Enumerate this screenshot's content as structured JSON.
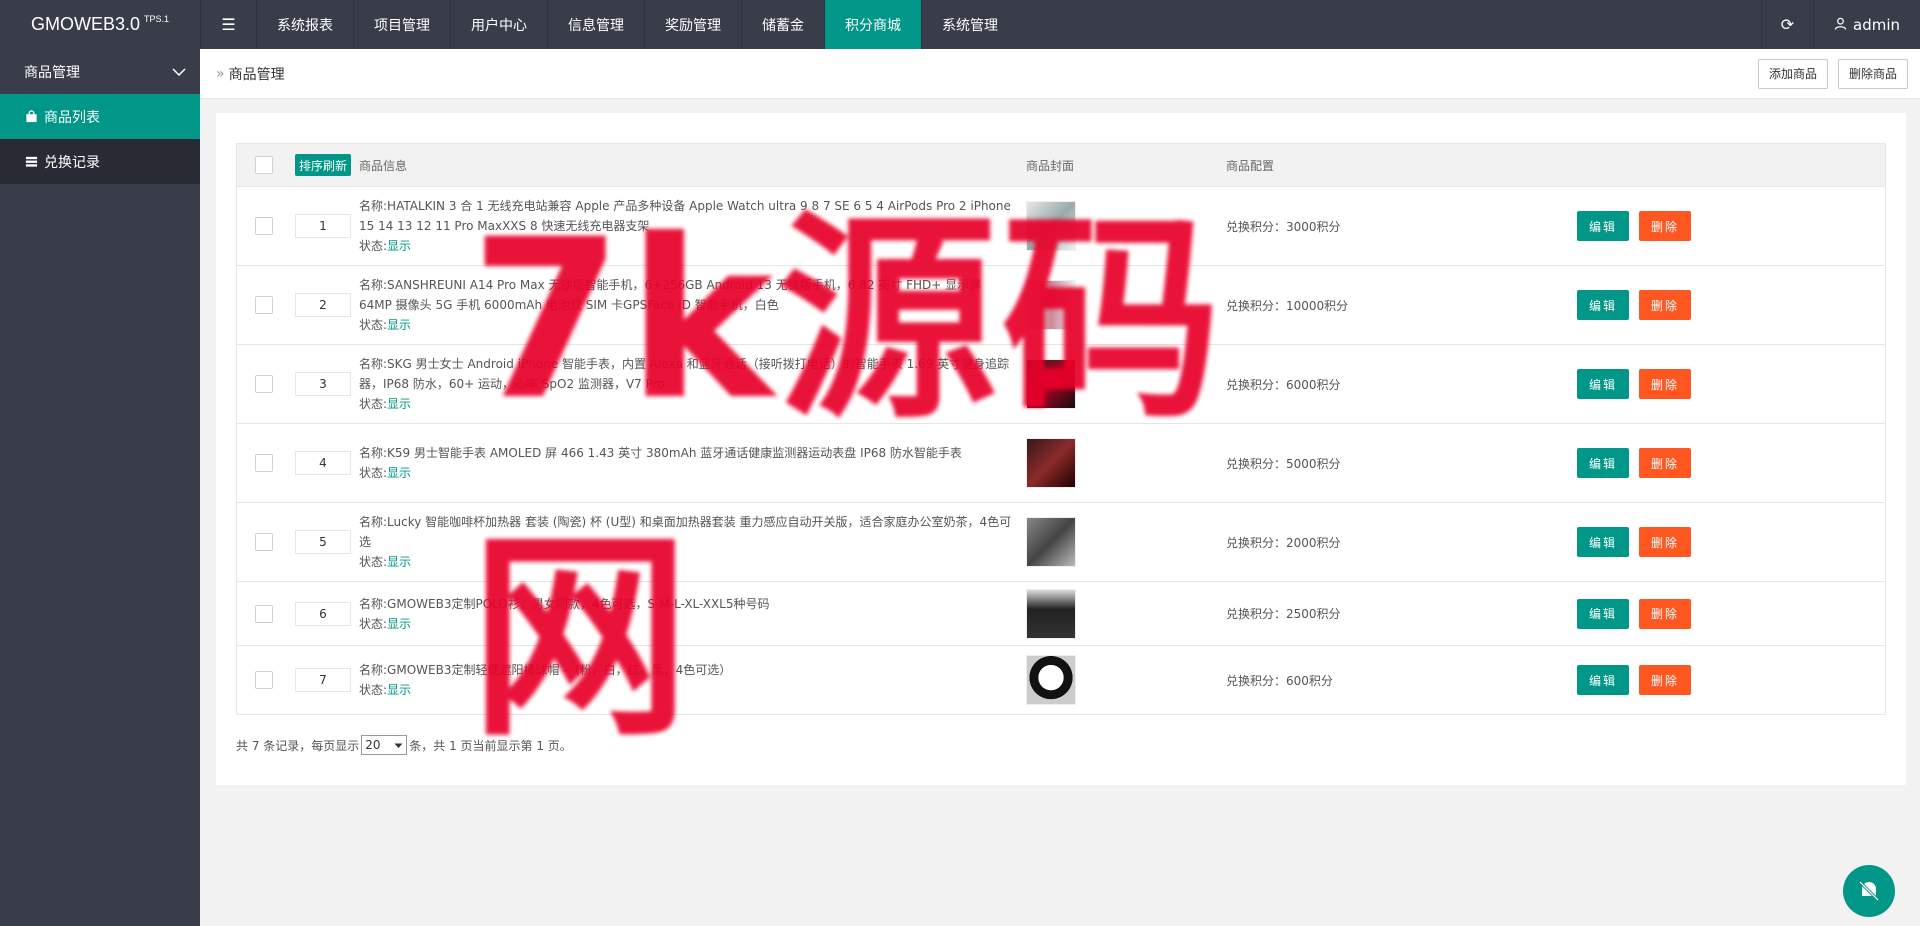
{
  "header": {
    "logo": "GMOWEB3.0",
    "logo_sup": "TPS.1",
    "menu_toggle_icon": "menu-icon",
    "nav": [
      "系统报表",
      "项目管理",
      "用户中心",
      "信息管理",
      "奖励管理",
      "储蓄金",
      "积分商城",
      "系统管理"
    ],
    "active_nav_index": 6,
    "refresh_icon": "refresh-icon",
    "user": "admin"
  },
  "sidebar": {
    "group": "商品管理",
    "items": [
      {
        "label": "商品列表",
        "icon": "shopping-bag-icon",
        "active": true
      },
      {
        "label": "兑换记录",
        "icon": "list-icon",
        "active": false
      }
    ]
  },
  "breadcrumb": {
    "current": "商品管理",
    "add_button": "添加商品",
    "delete_button": "删除商品"
  },
  "table": {
    "headers": {
      "sort_button": "排序刷新",
      "info": "商品信息",
      "cover": "商品封面",
      "config": "商品配置"
    },
    "rows": [
      {
        "sort": "1",
        "name_label": "名称:",
        "name": "HATALKIN 3 合 1 无线充电站兼容 Apple 产品多种设备 Apple Watch ultra 9 8 7 SE 6 5 4 AirPods Pro 2 iPhone 15 14 13 12 11 Pro MaxXXS 8 快速无线充电器支架",
        "status_label": "状态:",
        "status": "显示",
        "config": "兑换积分：3000积分"
      },
      {
        "sort": "2",
        "name_label": "名称:",
        "name": "SANSHREUNI A14 Pro Max 无锁版智能手机，6+256GB Android 13 无锁版手机，6.82 英寸 FHD+ 显示屏 64MP 摄像头 5G 手机 6000mAh 电池双 SIM 卡GPSFace ID 智能手机，白色",
        "status_label": "状态:",
        "status": "显示",
        "config": "兑换积分：10000积分"
      },
      {
        "sort": "3",
        "name_label": "名称:",
        "name": "SKG 男士女士 Android iPhone 智能手表，内置 Alexa 和蓝牙通话（接听拨打电话）的智能手表 1.69 英寸健身追踪器，IP68 防水，60+ 运动，心率 SpO2 监测器，V7 Pro",
        "status_label": "状态:",
        "status": "显示",
        "config": "兑换积分：6000积分"
      },
      {
        "sort": "4",
        "name_label": "名称:",
        "name": "K59 男士智能手表 AMOLED 屏 466 1.43 英寸 380mAh 蓝牙通话健康监测器运动表盘 IP68 防水智能手表",
        "status_label": "状态:",
        "status": "显示",
        "config": "兑换积分：5000积分"
      },
      {
        "sort": "5",
        "name_label": "名称:",
        "name": "Lucky 智能咖啡杯加热器 套装 (陶瓷) 杯 (U型) 和桌面加热器套装 重力感应自动开关版，适合家庭办公室奶茶，4色可选",
        "status_label": "状态:",
        "status": "显示",
        "config": "兑换积分：2000积分"
      },
      {
        "sort": "6",
        "name_label": "名称:",
        "name": "GMOWEB3定制POLO衫，男女同款，4色可选，S-M-L-XL-XXL5种号码",
        "status_label": "状态:",
        "status": "显示",
        "config": "兑换积分：2500积分"
      },
      {
        "sort": "7",
        "name_label": "名称:",
        "name": "GMOWEB3定制轻便遮阳棒球帽 -（粉，白，红，黑，4色可选）",
        "status_label": "状态:",
        "status": "显示",
        "config": "兑换积分：600积分"
      }
    ],
    "edit_label": "编辑",
    "delete_label": "删除"
  },
  "pager": {
    "before": "共 7 条记录，每页显示",
    "page_size": "20",
    "after": "条，共 1 页当前显示第 1 页。"
  },
  "watermark": "7k源码网",
  "colors": {
    "header_bg": "#393d49",
    "accent": "#009688",
    "danger": "#ff5722",
    "watermark": "#e8002a"
  }
}
